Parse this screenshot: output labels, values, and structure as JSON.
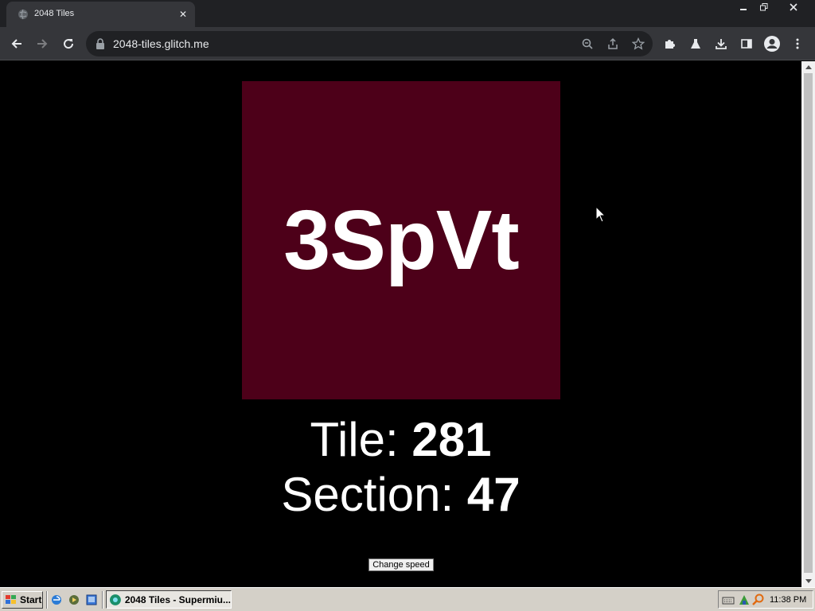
{
  "browser": {
    "tab_title": "2048 Tiles",
    "url": "2048-tiles.glitch.me"
  },
  "page": {
    "tile_word": "3SpVt",
    "tile_color": "#4d0019",
    "tile_label": "Tile: ",
    "tile_number": "281",
    "section_label": "Section: ",
    "section_number": "47",
    "speed_button": "Change speed"
  },
  "taskbar": {
    "start_label": "Start",
    "task_label": "2048 Tiles - Supermiu...",
    "clock": "11:38 PM"
  },
  "colors": {
    "chrome_dark": "#202124",
    "chrome_toolbar": "#35363a",
    "taskbar": "#d4d0c8"
  }
}
